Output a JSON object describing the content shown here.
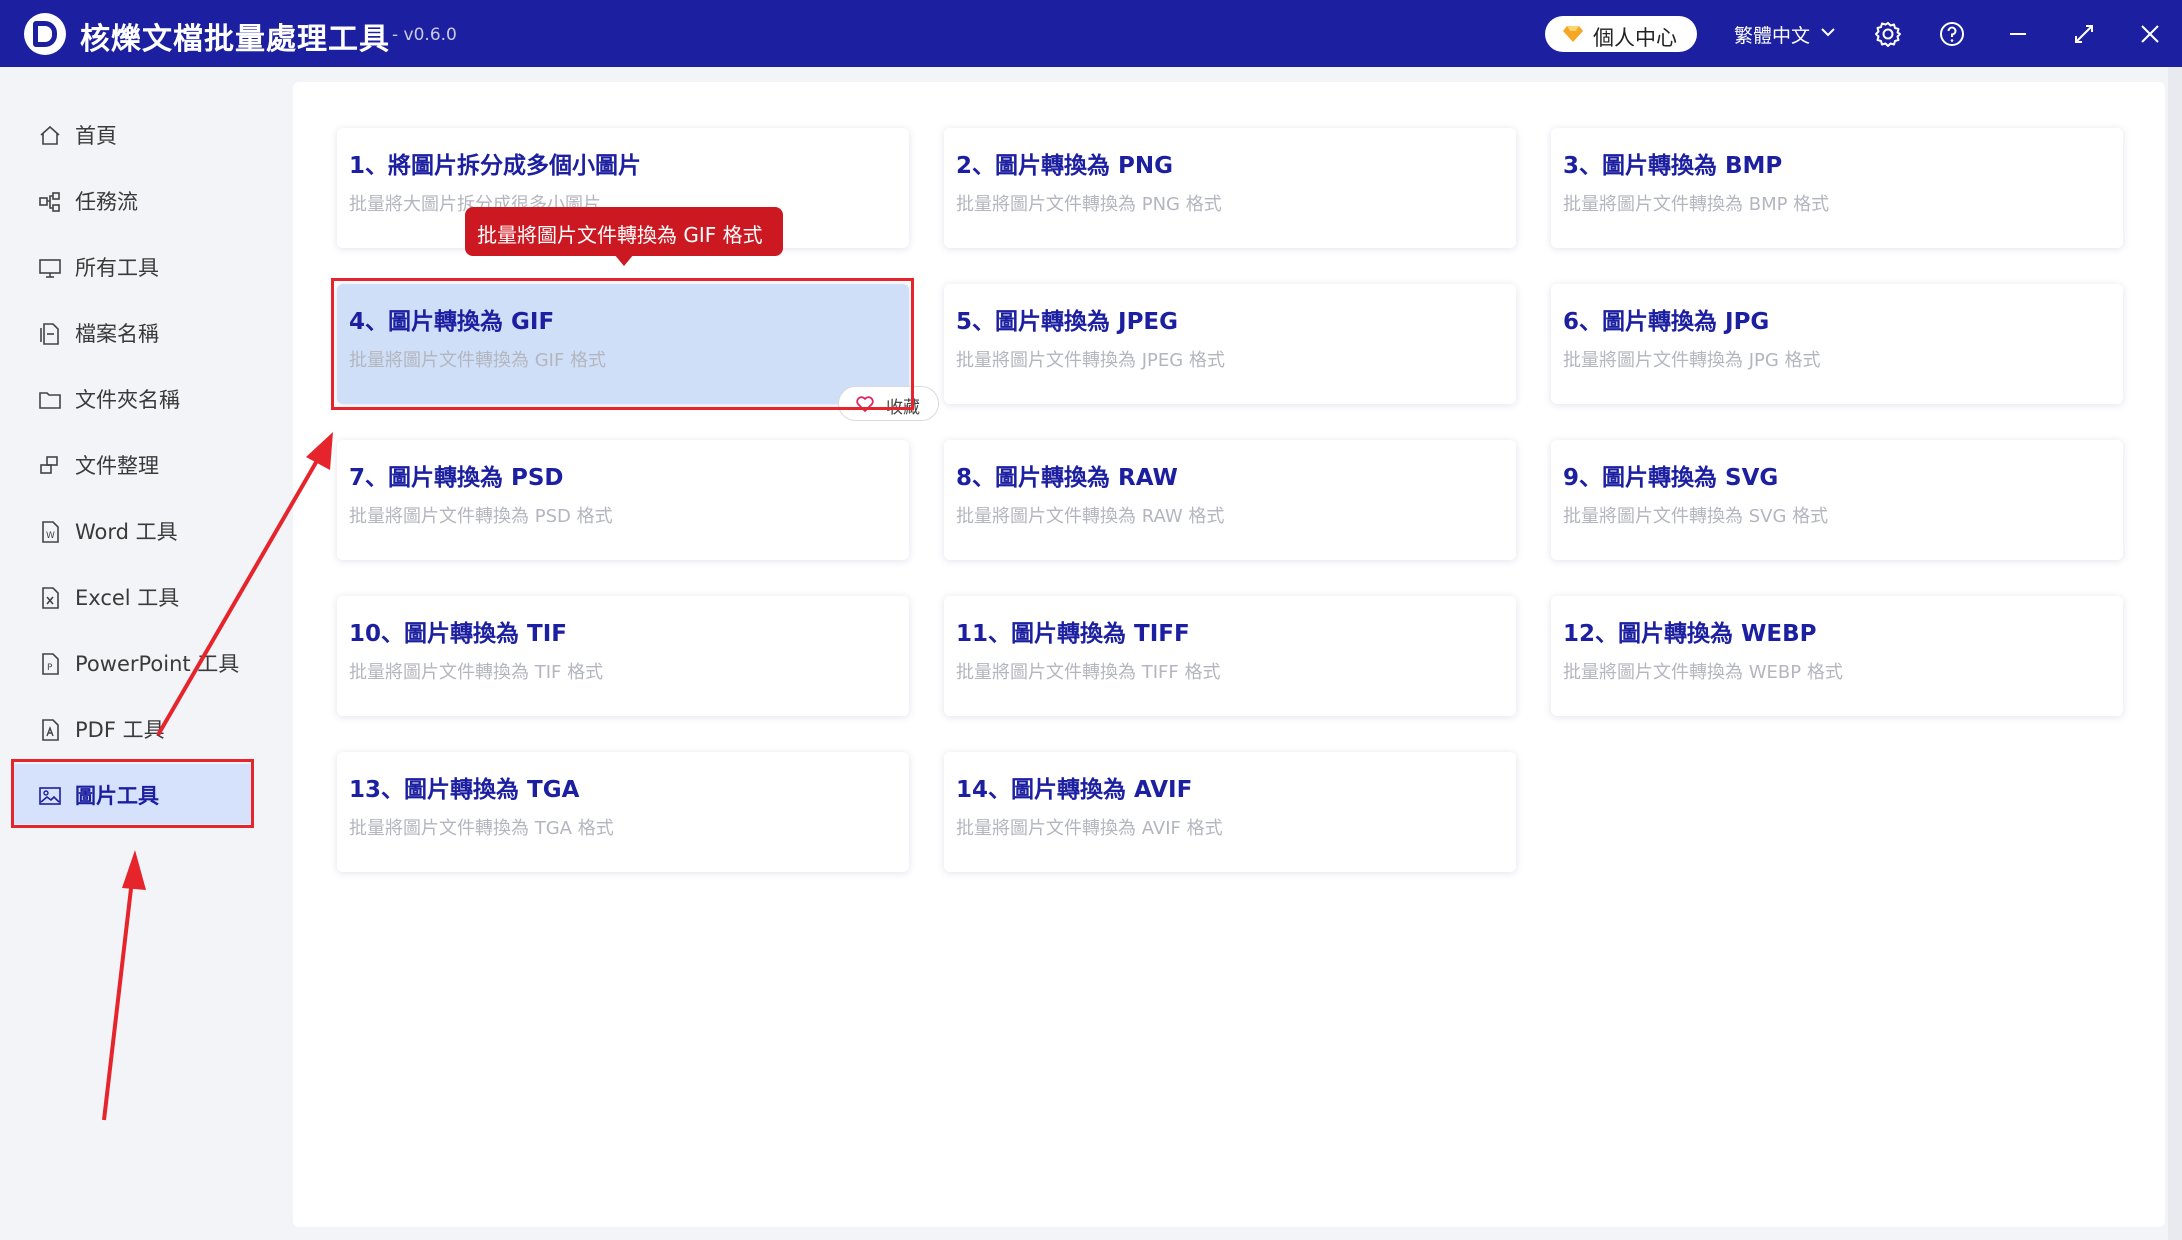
{
  "app": {
    "title": "核爍文檔批量處理工具",
    "version": "- v0.6.0",
    "user_center": "個人中心",
    "language": "繁體中文",
    "accent": "#1b1fa0",
    "highlight_red": "#e5242b"
  },
  "titlebar_icons": [
    "settings-icon",
    "help-icon",
    "minimize-icon",
    "maximize-icon",
    "close-icon"
  ],
  "sidebar": {
    "items": [
      {
        "label": "首頁",
        "icon": "home-icon"
      },
      {
        "label": "任務流",
        "icon": "workflow-icon"
      },
      {
        "label": "所有工具",
        "icon": "monitor-icon"
      },
      {
        "label": "檔案名稱",
        "icon": "file-icon"
      },
      {
        "label": "文件夾名稱",
        "icon": "folder-icon"
      },
      {
        "label": "文件整理",
        "icon": "organize-icon"
      },
      {
        "label": "Word 工具",
        "icon": "word-icon"
      },
      {
        "label": "Excel 工具",
        "icon": "excel-icon"
      },
      {
        "label": "PowerPoint 工具",
        "icon": "powerpoint-icon"
      },
      {
        "label": "PDF 工具",
        "icon": "pdf-icon"
      },
      {
        "label": "圖片工具",
        "icon": "image-icon",
        "active": true
      }
    ]
  },
  "tools": [
    {
      "title": "1、將圖片拆分成多個小圖片",
      "desc": "批量將大圖片拆分成很多小圖片"
    },
    {
      "title": "2、圖片轉換為 PNG",
      "desc": "批量將圖片文件轉換為 PNG 格式"
    },
    {
      "title": "3、圖片轉換為 BMP",
      "desc": "批量將圖片文件轉換為 BMP 格式"
    },
    {
      "title": "4、圖片轉換為 GIF",
      "desc": "批量將圖片文件轉換為 GIF 格式",
      "active": true
    },
    {
      "title": "5、圖片轉換為 JPEG",
      "desc": "批量將圖片文件轉換為 JPEG 格式"
    },
    {
      "title": "6、圖片轉換為 JPG",
      "desc": "批量將圖片文件轉換為 JPG 格式"
    },
    {
      "title": "7、圖片轉換為 PSD",
      "desc": "批量將圖片文件轉換為 PSD 格式"
    },
    {
      "title": "8、圖片轉換為 RAW",
      "desc": "批量將圖片文件轉換為 RAW 格式"
    },
    {
      "title": "9、圖片轉換為 SVG",
      "desc": "批量將圖片文件轉換為 SVG 格式"
    },
    {
      "title": "10、圖片轉換為 TIF",
      "desc": "批量將圖片文件轉換為 TIF 格式"
    },
    {
      "title": "11、圖片轉換為 TIFF",
      "desc": "批量將圖片文件轉換為 TIFF 格式"
    },
    {
      "title": "12、圖片轉換為 WEBP",
      "desc": "批量將圖片文件轉換為 WEBP 格式"
    },
    {
      "title": "13、圖片轉換為 TGA",
      "desc": "批量將圖片文件轉換為 TGA 格式"
    },
    {
      "title": "14、圖片轉換為 AVIF",
      "desc": "批量將圖片文件轉換為 AVIF 格式"
    }
  ],
  "favorite_label": "收藏",
  "tooltip": "批量將圖片文件轉換為 GIF 格式"
}
